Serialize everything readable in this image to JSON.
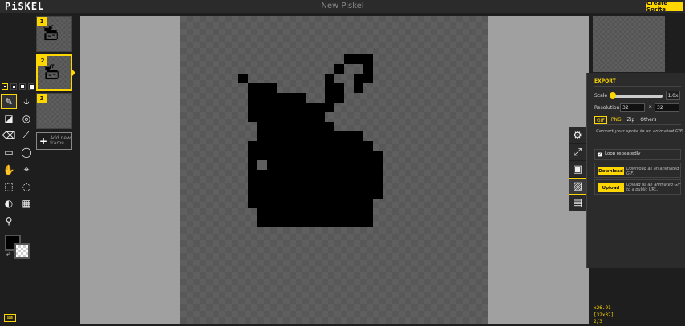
{
  "app": {
    "logo": "PiSKEL",
    "title": "New Piskel",
    "create_button": "Create Sprite"
  },
  "tools": {
    "pen_sizes": [
      1,
      2,
      3,
      4
    ],
    "items": [
      "pen-icon",
      "vertical-mirror-icon",
      "paint-bucket-icon",
      "paint-all-same-color-icon",
      "eraser-icon",
      "stroke-icon",
      "rectangle-icon",
      "circle-icon",
      "move-icon",
      "shape-select-icon",
      "rectangle-select-icon",
      "lasso-select-icon",
      "lighten-icon",
      "dithering-icon",
      "color-picker-icon"
    ],
    "primary_color": "#000000",
    "secondary_color": "transparent"
  },
  "frames": {
    "items": [
      {
        "number": "1"
      },
      {
        "number": "2"
      },
      {
        "number": "3"
      }
    ],
    "selected": "2",
    "add_label": "Add new frame"
  },
  "export": {
    "heading": "EXPORT",
    "scale_label": "Scale",
    "scale_value": "1.0x",
    "resolution_label": "Resolution",
    "width": "32",
    "height": "32",
    "x_sep": "x",
    "tabs": [
      "GIF",
      "PNG",
      "Zip",
      "Others"
    ],
    "active_tab": "GIF",
    "tab_description": "Convert your sprite to an animated GIF.",
    "loop_label": "Loop repeatedly",
    "loop_checked": true,
    "download_label": "Download",
    "download_desc": "Download as an animated GIF.",
    "upload_label": "Upload",
    "upload_desc": "Upload as an animated GIF to a public URL."
  },
  "side_icons": [
    "settings-icon",
    "resize-icon",
    "save-icon",
    "export-icon",
    "import-icon"
  ],
  "status": {
    "zoom": "x26.91",
    "size": "[32x32]",
    "frame": "2/3"
  },
  "colors": {
    "accent": "#ffd700",
    "background": "#1e1e1e"
  }
}
